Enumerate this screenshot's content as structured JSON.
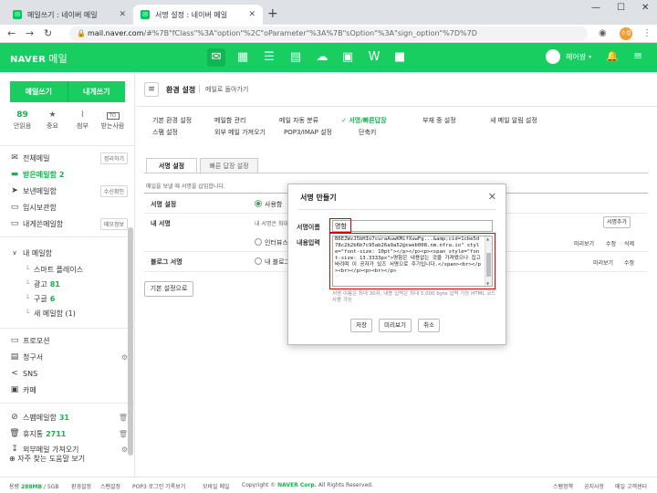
{
  "browser": {
    "tabs": [
      {
        "title": "메일쓰기 : 네이버 메일",
        "active": false
      },
      {
        "title": "서명 설정 : 네이버 메일",
        "active": true
      }
    ],
    "new_tab": "+",
    "url_host": "mail.naver.com",
    "url_path": "/#%7B\"fClass\"%3A\"option\"%2C\"oParameter\"%3A%7B\"sOption\"%3A\"sign_option\"%7D%7D",
    "profile_label": "소셜"
  },
  "header": {
    "brand": "NAVER",
    "product": "메일",
    "user_name": "헤어짱",
    "brand_color": "#19ce60"
  },
  "sidebar": {
    "compose_label": "메일쓰기",
    "self_compose_label": "내게쓰기",
    "quick_stats": [
      {
        "value": "89",
        "label": "안읽음",
        "icon": null
      },
      {
        "value": null,
        "label": "중요",
        "icon": "star-icon"
      },
      {
        "value": null,
        "label": "첨부",
        "icon": "clip-icon"
      },
      {
        "value": null,
        "label": "받는사람",
        "icon": "to-icon"
      }
    ],
    "to_icon_text": "TO",
    "mailboxes": [
      {
        "label": "전체메일",
        "badge": "정리하기"
      },
      {
        "label": "받은메일함",
        "count": "2"
      },
      {
        "label": "보낸메일함",
        "badge": "수신확인"
      },
      {
        "label": "임시보관함"
      },
      {
        "label": "내게쓴메일함",
        "badge": "메모정보"
      }
    ],
    "my_folders_label": "내 메일함",
    "folders": [
      {
        "label": "스마트 플레이스"
      },
      {
        "label": "광고",
        "count": "81"
      },
      {
        "label": "구글",
        "count": "6"
      },
      {
        "label": "새 메일함 (1)"
      }
    ],
    "extras": [
      {
        "label": "프로모션"
      },
      {
        "label": "청구서"
      },
      {
        "label": "SNS"
      },
      {
        "label": "카페"
      }
    ],
    "bottom": [
      {
        "label": "스팸메일함",
        "count": "31"
      },
      {
        "label": "휴지통",
        "count": "2711"
      },
      {
        "label": "외부메일 가져오기"
      }
    ],
    "help_label": "자주 찾는 도움말 보기"
  },
  "footer": {
    "usage_prefix": "용량",
    "usage_value": "288MB",
    "usage_total": "/ 5GB",
    "links": [
      "환경설정",
      "스팬설정",
      "POP3 로그인 기록보기",
      "모바일 메일"
    ],
    "copyright": "Copyright ©",
    "company": "NAVER Corp.",
    "rights": "All Rights Reserved.",
    "right_links": [
      "스팸정책",
      "공지사항",
      "메일 고객센터"
    ]
  },
  "settings": {
    "title": "환경 설정",
    "back_link": "메일로 돌아가기",
    "menu": [
      "기본 환경 설정",
      "메일함 관리",
      "메일 자동 분류",
      "서명/빠른답장",
      "부재 중 설정",
      "새 메일 알림 설정",
      "스팸 설정",
      "외부 메일 가져오기",
      "POP3/IMAP 설정",
      "단축키"
    ],
    "active_menu": "서명/빠른답장",
    "tabs": [
      "서명 설정",
      "빠른 답장 설정"
    ],
    "active_tab": "서명 설정",
    "description": "메일을 보낼 때 서명을 삽입합니다.",
    "rows": [
      {
        "label": "서명 설정",
        "option": "사용함"
      },
      {
        "label": "내 서명",
        "option": "내 서명은 최대 ...",
        "button": "서명추가"
      },
      {
        "label": "",
        "option": "인터뷰스",
        "actions": [
          "미리보기",
          "수정",
          "삭제"
        ]
      },
      {
        "label": "블로그 서명",
        "option": "내 블로그 정보",
        "actions": [
          "미리보기",
          "수정"
        ]
      }
    ],
    "default_button": "기본 설정으로"
  },
  "dialog": {
    "title": "서명 만들기",
    "close": "✕",
    "name_label": "서명이름",
    "body_label": "내용입력",
    "name_value": "명함",
    "body_value": "B6EZWzJ5bHIo7curaAuwKMifXuwFg...&amp;cid=1cbe5d78c2b2b6b7c95ab26a9a52@cweb008.nm.nfra.io\" style=\"font-size: 10pt\"></p></p><p><span style=\"font-size: 13.3333px\">명함은 내용없는 것을 가져왔으나 집고바려며 이 공자가 있즈 서명으로 주기입니다.</span><br></p><br></p><p><br></p>",
    "note": "서명 이름은 최대 30자, 내용 입력은 최대 5,000 byte 입력 가능 HTML 코드 사용 가능",
    "buttons": [
      "저장",
      "미리보기",
      "취소"
    ],
    "highlight_color": "#dd0000"
  }
}
